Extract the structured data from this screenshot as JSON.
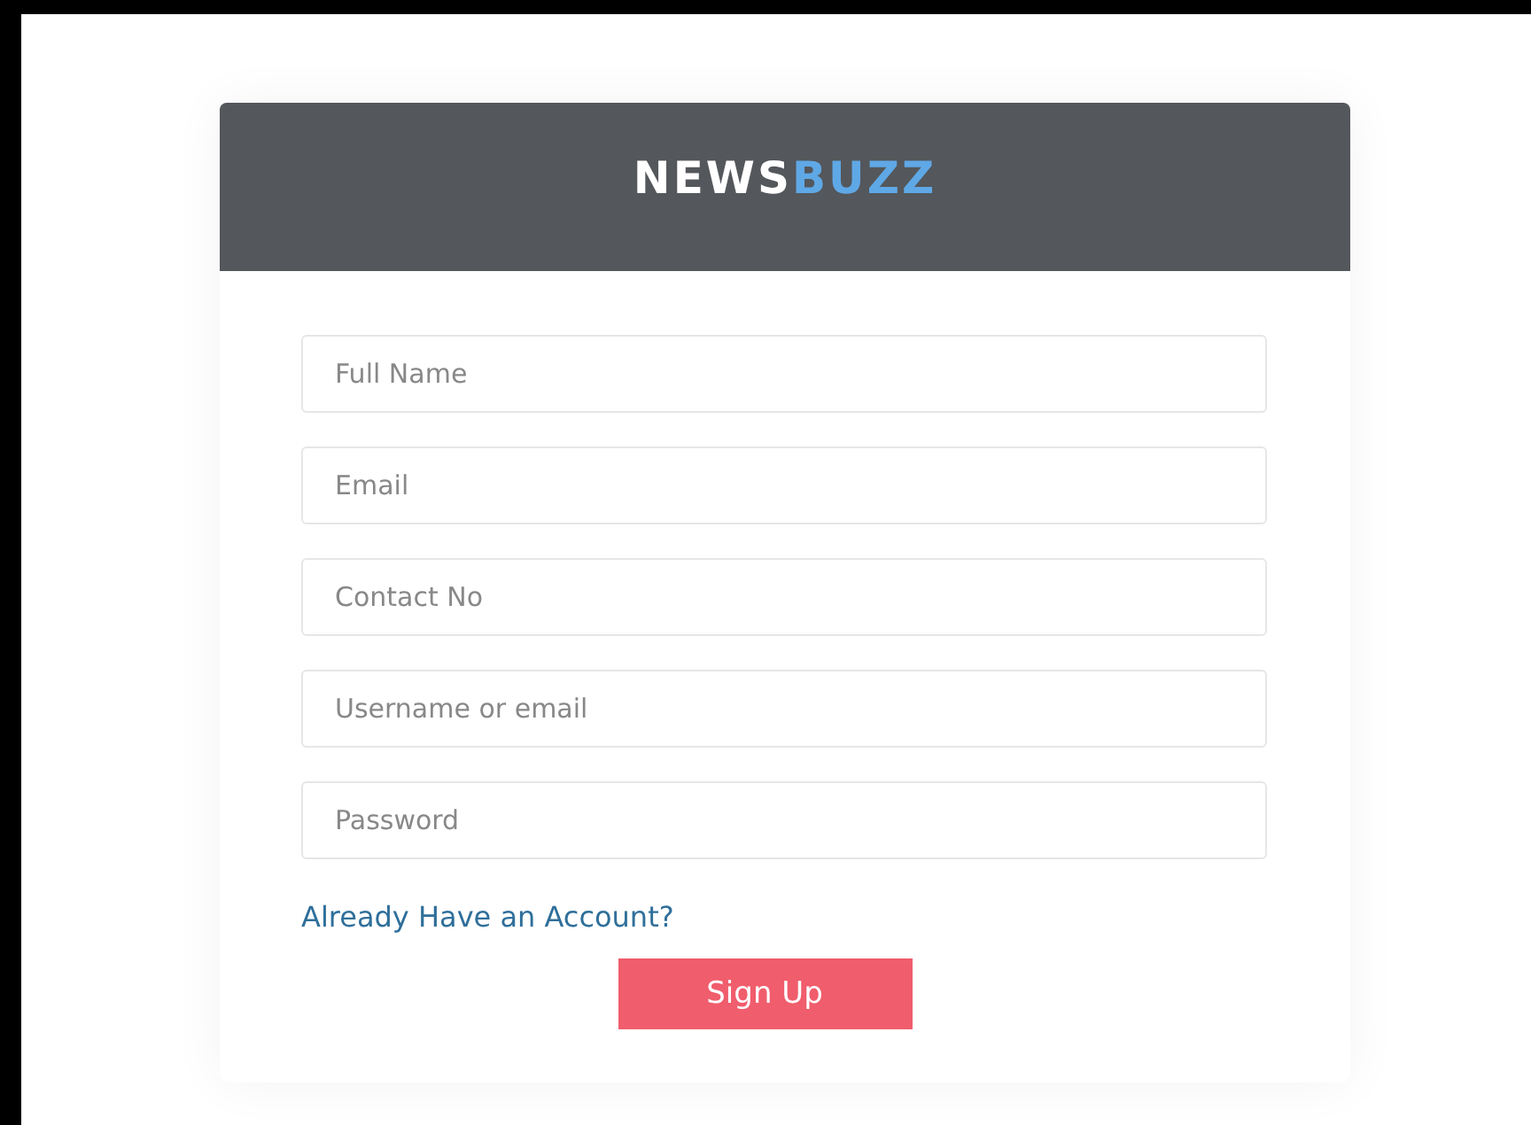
{
  "logo": {
    "first": "NEWS",
    "second": "BUZZ"
  },
  "fields": [
    {
      "placeholder": "Full Name"
    },
    {
      "placeholder": "Email"
    },
    {
      "placeholder": "Contact No"
    },
    {
      "placeholder": "Username or email"
    },
    {
      "placeholder": "Password"
    }
  ],
  "link": "Already Have an Account?",
  "button": "Sign Up"
}
